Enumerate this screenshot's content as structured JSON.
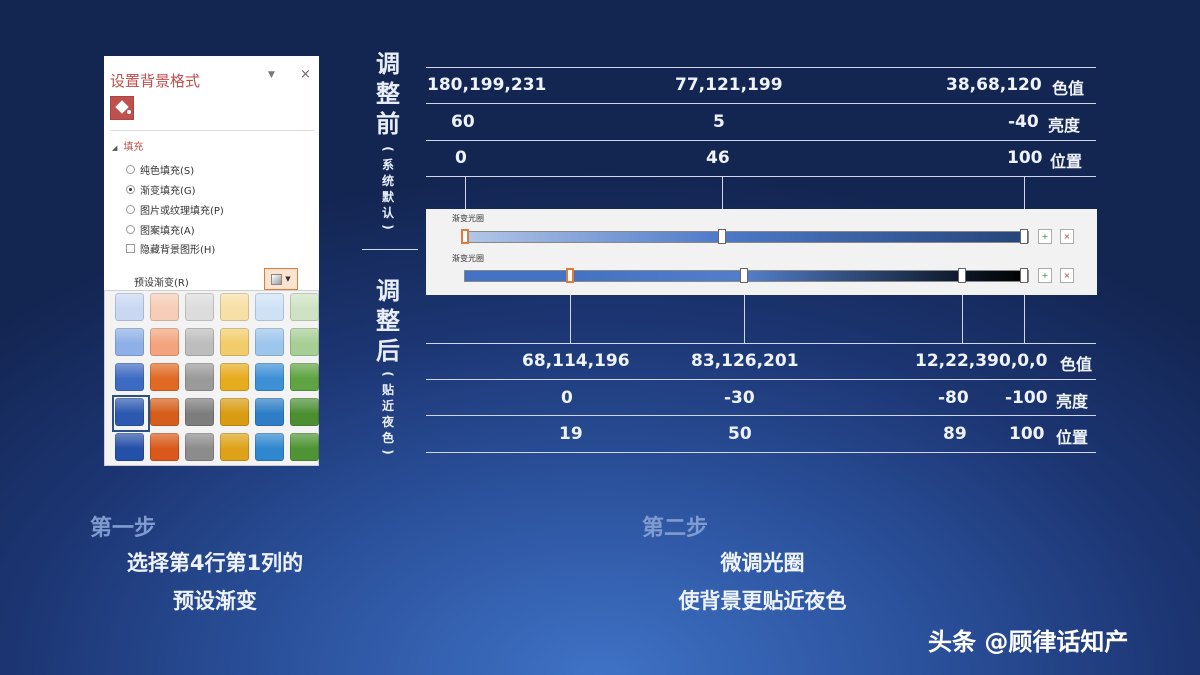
{
  "panel": {
    "title": "设置背景格式",
    "pin": "▼",
    "close": "×",
    "section": "填充",
    "options": [
      "纯色填充(S)",
      "渐变填充(G)",
      "图片或纹理填充(P)",
      "图案填充(A)"
    ],
    "selected_option": 1,
    "hide_bg_label": "隐藏背景图形(H)",
    "preset_label": "预设渐变(R)",
    "preset_colors": [
      [
        "#c9d8f2",
        "#f6cdb6",
        "#dcdcdc",
        "#f7e0a5",
        "#cfe2f5",
        "#cfe3c4"
      ],
      [
        "#8fb0e6",
        "#f3a47e",
        "#bdbdbd",
        "#f2cc6a",
        "#9cc6ec",
        "#a7ce95"
      ],
      [
        "#3e6bc2",
        "#e06a24",
        "#9a9a9a",
        "#e7ab1e",
        "#3d8fd6",
        "#5fa343"
      ],
      [
        "#2c58b0",
        "#d45e1a",
        "#7d7d7d",
        "#d99b12",
        "#2d7ec7",
        "#4c8f33"
      ],
      [
        "#2550a8",
        "#d9581a",
        "#8c8c8c",
        "#dea21a",
        "#2f87d0",
        "#4e9434"
      ]
    ]
  },
  "before": {
    "label_main": [
      "调",
      "整",
      "前"
    ],
    "label_sub": [
      "(",
      "系",
      "统",
      "默",
      "认",
      ")"
    ],
    "rows": [
      {
        "cells": [
          "180,199,231",
          "77,121,199",
          "38,68,120"
        ],
        "unit": "色值"
      },
      {
        "cells": [
          "60",
          "5",
          "-40"
        ],
        "unit": "亮度"
      },
      {
        "cells": [
          "0",
          "46",
          "100"
        ],
        "unit": "位置"
      }
    ]
  },
  "after": {
    "label_main": [
      "调",
      "整",
      "后"
    ],
    "label_sub": [
      "(",
      "贴",
      "近",
      "夜",
      "色",
      ")"
    ],
    "rows": [
      {
        "cells": [
          "68,114,196",
          "83,126,201",
          "12,22,39",
          "0,0,0"
        ],
        "unit": "色值"
      },
      {
        "cells": [
          "0",
          "-30",
          "-80",
          "-100"
        ],
        "unit": "亮度"
      },
      {
        "cells": [
          "19",
          "50",
          "89",
          "100"
        ],
        "unit": "位置"
      }
    ]
  },
  "strip": {
    "label1": "渐变光圈",
    "label2": "渐变光圈"
  },
  "step1": {
    "title": "第一步",
    "line1": "选择第4行第1列的",
    "line2": "预设渐变"
  },
  "step2": {
    "title": "第二步",
    "line1": "微调光圈",
    "line2": "使背景更贴近夜色"
  },
  "watermark": "头条 @顾律话知产"
}
